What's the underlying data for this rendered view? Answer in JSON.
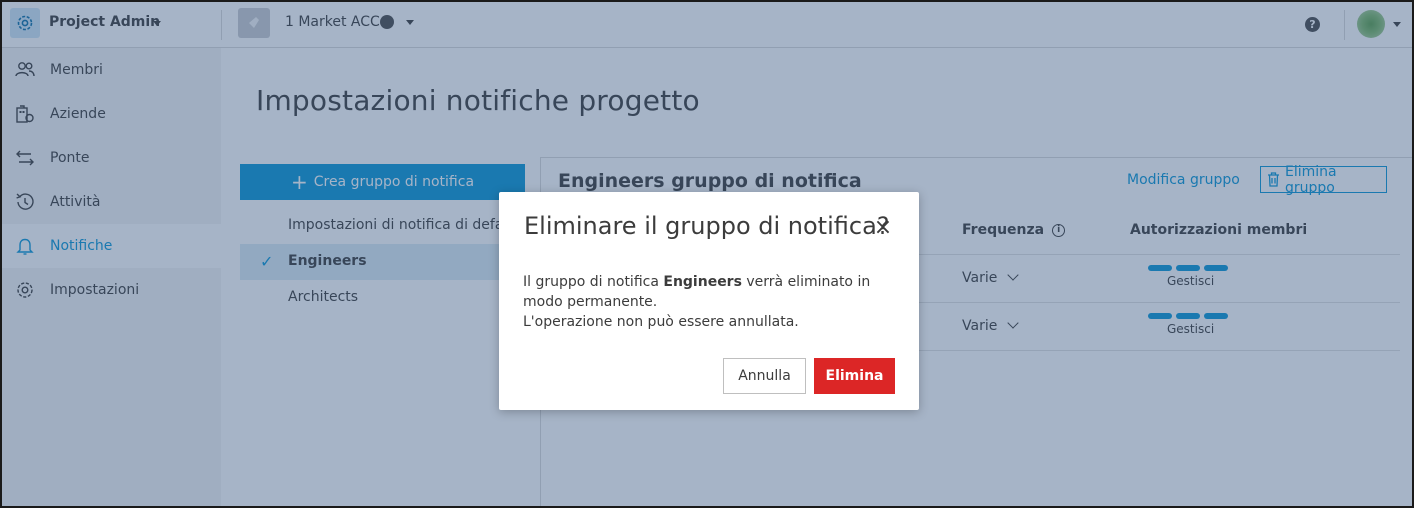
{
  "topbar": {
    "app_name": "Project Admin",
    "project_name": "1 Market ACC",
    "help_symbol": "?",
    "icons": [
      "gear-icon",
      "project-thumbnail-icon",
      "globe-icon",
      "help-icon",
      "avatar"
    ]
  },
  "sidebar": {
    "items": [
      {
        "label": "Membri",
        "icon": "members-icon"
      },
      {
        "label": "Aziende",
        "icon": "companies-icon"
      },
      {
        "label": "Ponte",
        "icon": "bridge-icon"
      },
      {
        "label": "Attività",
        "icon": "activity-icon"
      },
      {
        "label": "Notifiche",
        "icon": "bell-icon",
        "active": true
      },
      {
        "label": "Impostazioni",
        "icon": "settings-icon"
      }
    ]
  },
  "page": {
    "title": "Impostazioni notifiche progetto"
  },
  "groups": {
    "create_label": "Crea gruppo di notifica",
    "items": [
      {
        "label": "Impostazioni di notifica di default"
      },
      {
        "label": "Engineers",
        "selected": true
      },
      {
        "label": "Architects"
      }
    ]
  },
  "detail": {
    "title": "Engineers gruppo di notifica",
    "edit_label": "Modifica gruppo",
    "delete_label": "Elimina gruppo",
    "columns": {
      "frequency": "Frequenza",
      "permissions": "Autorizzazioni membri"
    },
    "rows": [
      {
        "frequency": "Varie",
        "permission": "Gestisci"
      },
      {
        "frequency": "Varie",
        "permission": "Gestisci"
      }
    ]
  },
  "modal": {
    "title": "Eliminare il gruppo di notifica?",
    "close_symbol": "×",
    "body_prefix": "Il gruppo di notifica ",
    "body_group": "Engineers",
    "body_suffix": " verrà eliminato in modo permanente.",
    "body_line2": "L'operazione non può essere annullata.",
    "cancel_label": "Annulla",
    "delete_label": "Elimina"
  },
  "colors": {
    "accent": "#0696d7",
    "danger": "#dc2626",
    "overlay": "rgba(52,84,128,0.44)"
  }
}
